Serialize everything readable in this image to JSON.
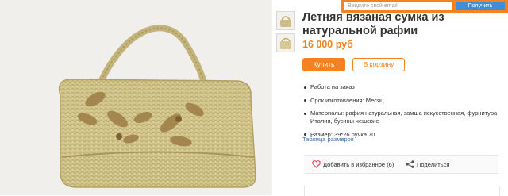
{
  "product": {
    "title": "Летняя вязаная сумка из натуральной рафии",
    "price": "16 000 руб",
    "buy_label": "Купить",
    "cart_label": "В корзину",
    "size_table_link": "Таблица размеров"
  },
  "features": [
    "Работа на заказ",
    "Срок изготовления: Месяц",
    "Материалы:  рафия натуральная, замша искусственная, фурнитура Италия, бусины чешские",
    "Размер:  39*26 ручка 70"
  ],
  "actions": {
    "favorite_label": "Добавить в избранное (6)",
    "share_label": "Поделиться"
  },
  "subscribe": {
    "placeholder": "Введите свой email",
    "button_label": "Получить"
  },
  "icons": {
    "favorite": "heart-icon",
    "share": "share-icon"
  },
  "colors": {
    "accent": "#f58220",
    "link": "#2f6db5",
    "subscribe_button": "#3e8fd8"
  }
}
